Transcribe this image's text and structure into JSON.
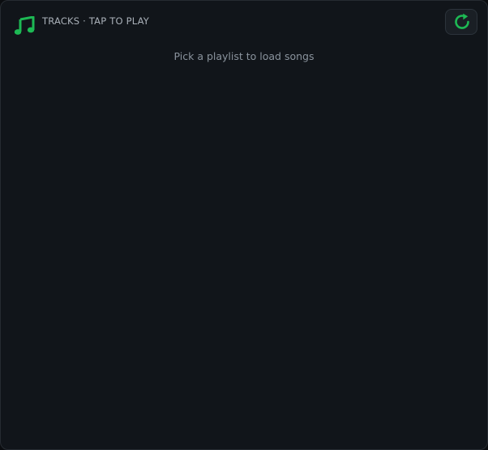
{
  "header": {
    "title": "TRACKS · TAP TO PLAY",
    "icon": "music-note-icon",
    "refresh_icon": "refresh-icon"
  },
  "list": {
    "empty_message": "Pick a playlist to load songs"
  },
  "colors": {
    "accent": "#1db954",
    "panel_background": "#11151a",
    "muted_text": "#8a939d",
    "header_text": "#a9b0b8"
  }
}
